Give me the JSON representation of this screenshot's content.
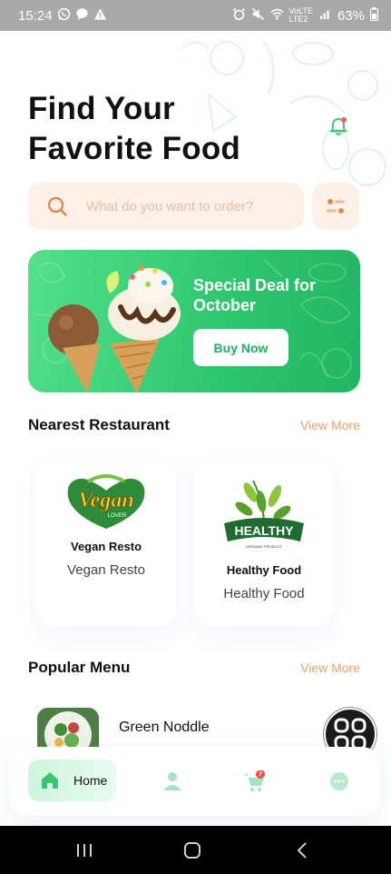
{
  "status_bar": {
    "time": "15:24",
    "network_top": "VoLTE",
    "network_bottom": "LTE2",
    "battery": "63%"
  },
  "header": {
    "title_line1": "Find Your",
    "title_line2": "Favorite Food"
  },
  "search": {
    "placeholder": "What do you want to order?",
    "value": ""
  },
  "promo": {
    "title": "Special Deal for October",
    "button_label": "Buy Now"
  },
  "nearest": {
    "title": "Nearest Restaurant",
    "view_more": "View More",
    "restaurants": [
      {
        "logo_text": "Vegan",
        "logo_sub": "LOVER",
        "name": "Vegan Resto",
        "subtitle": "Vegan Resto"
      },
      {
        "logo_text": "HEALTHY",
        "logo_sub": "ORGANIC PRODUCT",
        "name": "Healthy Food",
        "subtitle": "Healthy Food"
      }
    ]
  },
  "popular": {
    "title": "Popular Menu",
    "view_more": "View More",
    "items": [
      {
        "name": "Green Noddle"
      }
    ]
  },
  "bottom_nav": {
    "home_label": "Home",
    "cart_badge": "7"
  },
  "colors": {
    "accent_green": "#53e08a",
    "accent_orange": "#e6a26c",
    "search_bg": "#fdf1e7"
  }
}
